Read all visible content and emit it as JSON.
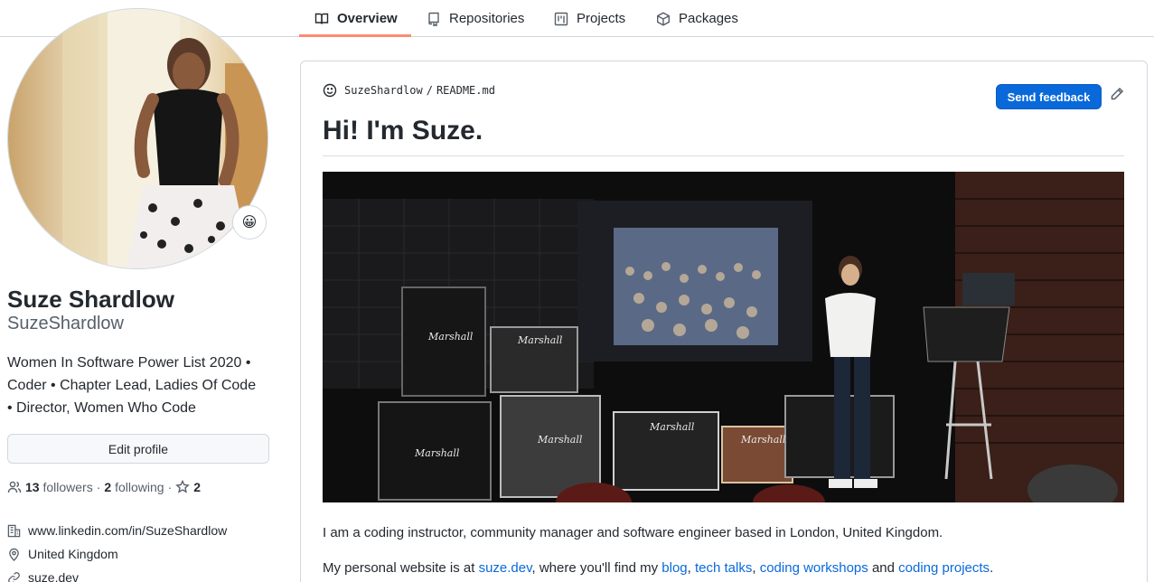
{
  "tabs": [
    {
      "label": "Overview",
      "icon": "book-icon",
      "active": true
    },
    {
      "label": "Repositories",
      "icon": "repo-icon",
      "active": false
    },
    {
      "label": "Projects",
      "icon": "project-icon",
      "active": false
    },
    {
      "label": "Packages",
      "icon": "package-icon",
      "active": false
    }
  ],
  "profile": {
    "status_emoji": "😀",
    "fullname": "Suze Shardlow",
    "username": "SuzeShardlow",
    "bio_lines": [
      "Women In Software Power List 2020 •",
      "Coder • Chapter Lead, Ladies Of Code",
      "• Director, Women Who Code"
    ],
    "edit_label": "Edit profile",
    "followers_count": "13",
    "followers_label": "followers",
    "sep": "·",
    "following_count": "2",
    "following_label": "following",
    "stars_count": "2",
    "details": [
      {
        "icon": "organization-icon",
        "text": "www.linkedin.com/in/SuzeShardlow"
      },
      {
        "icon": "location-icon",
        "text": "United Kingdom"
      },
      {
        "icon": "link-icon",
        "text": "suze.dev"
      }
    ]
  },
  "readme": {
    "owner": "SuzeShardlow",
    "slash": "/",
    "file": "README.md",
    "feedback_label": "Send feedback",
    "heading": "Hi! I'm Suze.",
    "para1": "I am a coding instructor, community manager and software engineer based in London, United Kingdom.",
    "para2_prefix": "My personal website is at ",
    "para2_link_site": "suze.dev",
    "para2_mid": ", where you'll find my ",
    "para2_link_blog": "blog",
    "para2_comma1": ", ",
    "para2_link_talks": "tech talks",
    "para2_comma2": ", ",
    "para2_link_workshops": "coding workshops",
    "para2_and": " and ",
    "para2_link_projects": "coding projects",
    "para2_end": "."
  },
  "colors": {
    "accent": "#0969da",
    "tab_underline": "#fd8c73",
    "border": "#d0d7de"
  }
}
